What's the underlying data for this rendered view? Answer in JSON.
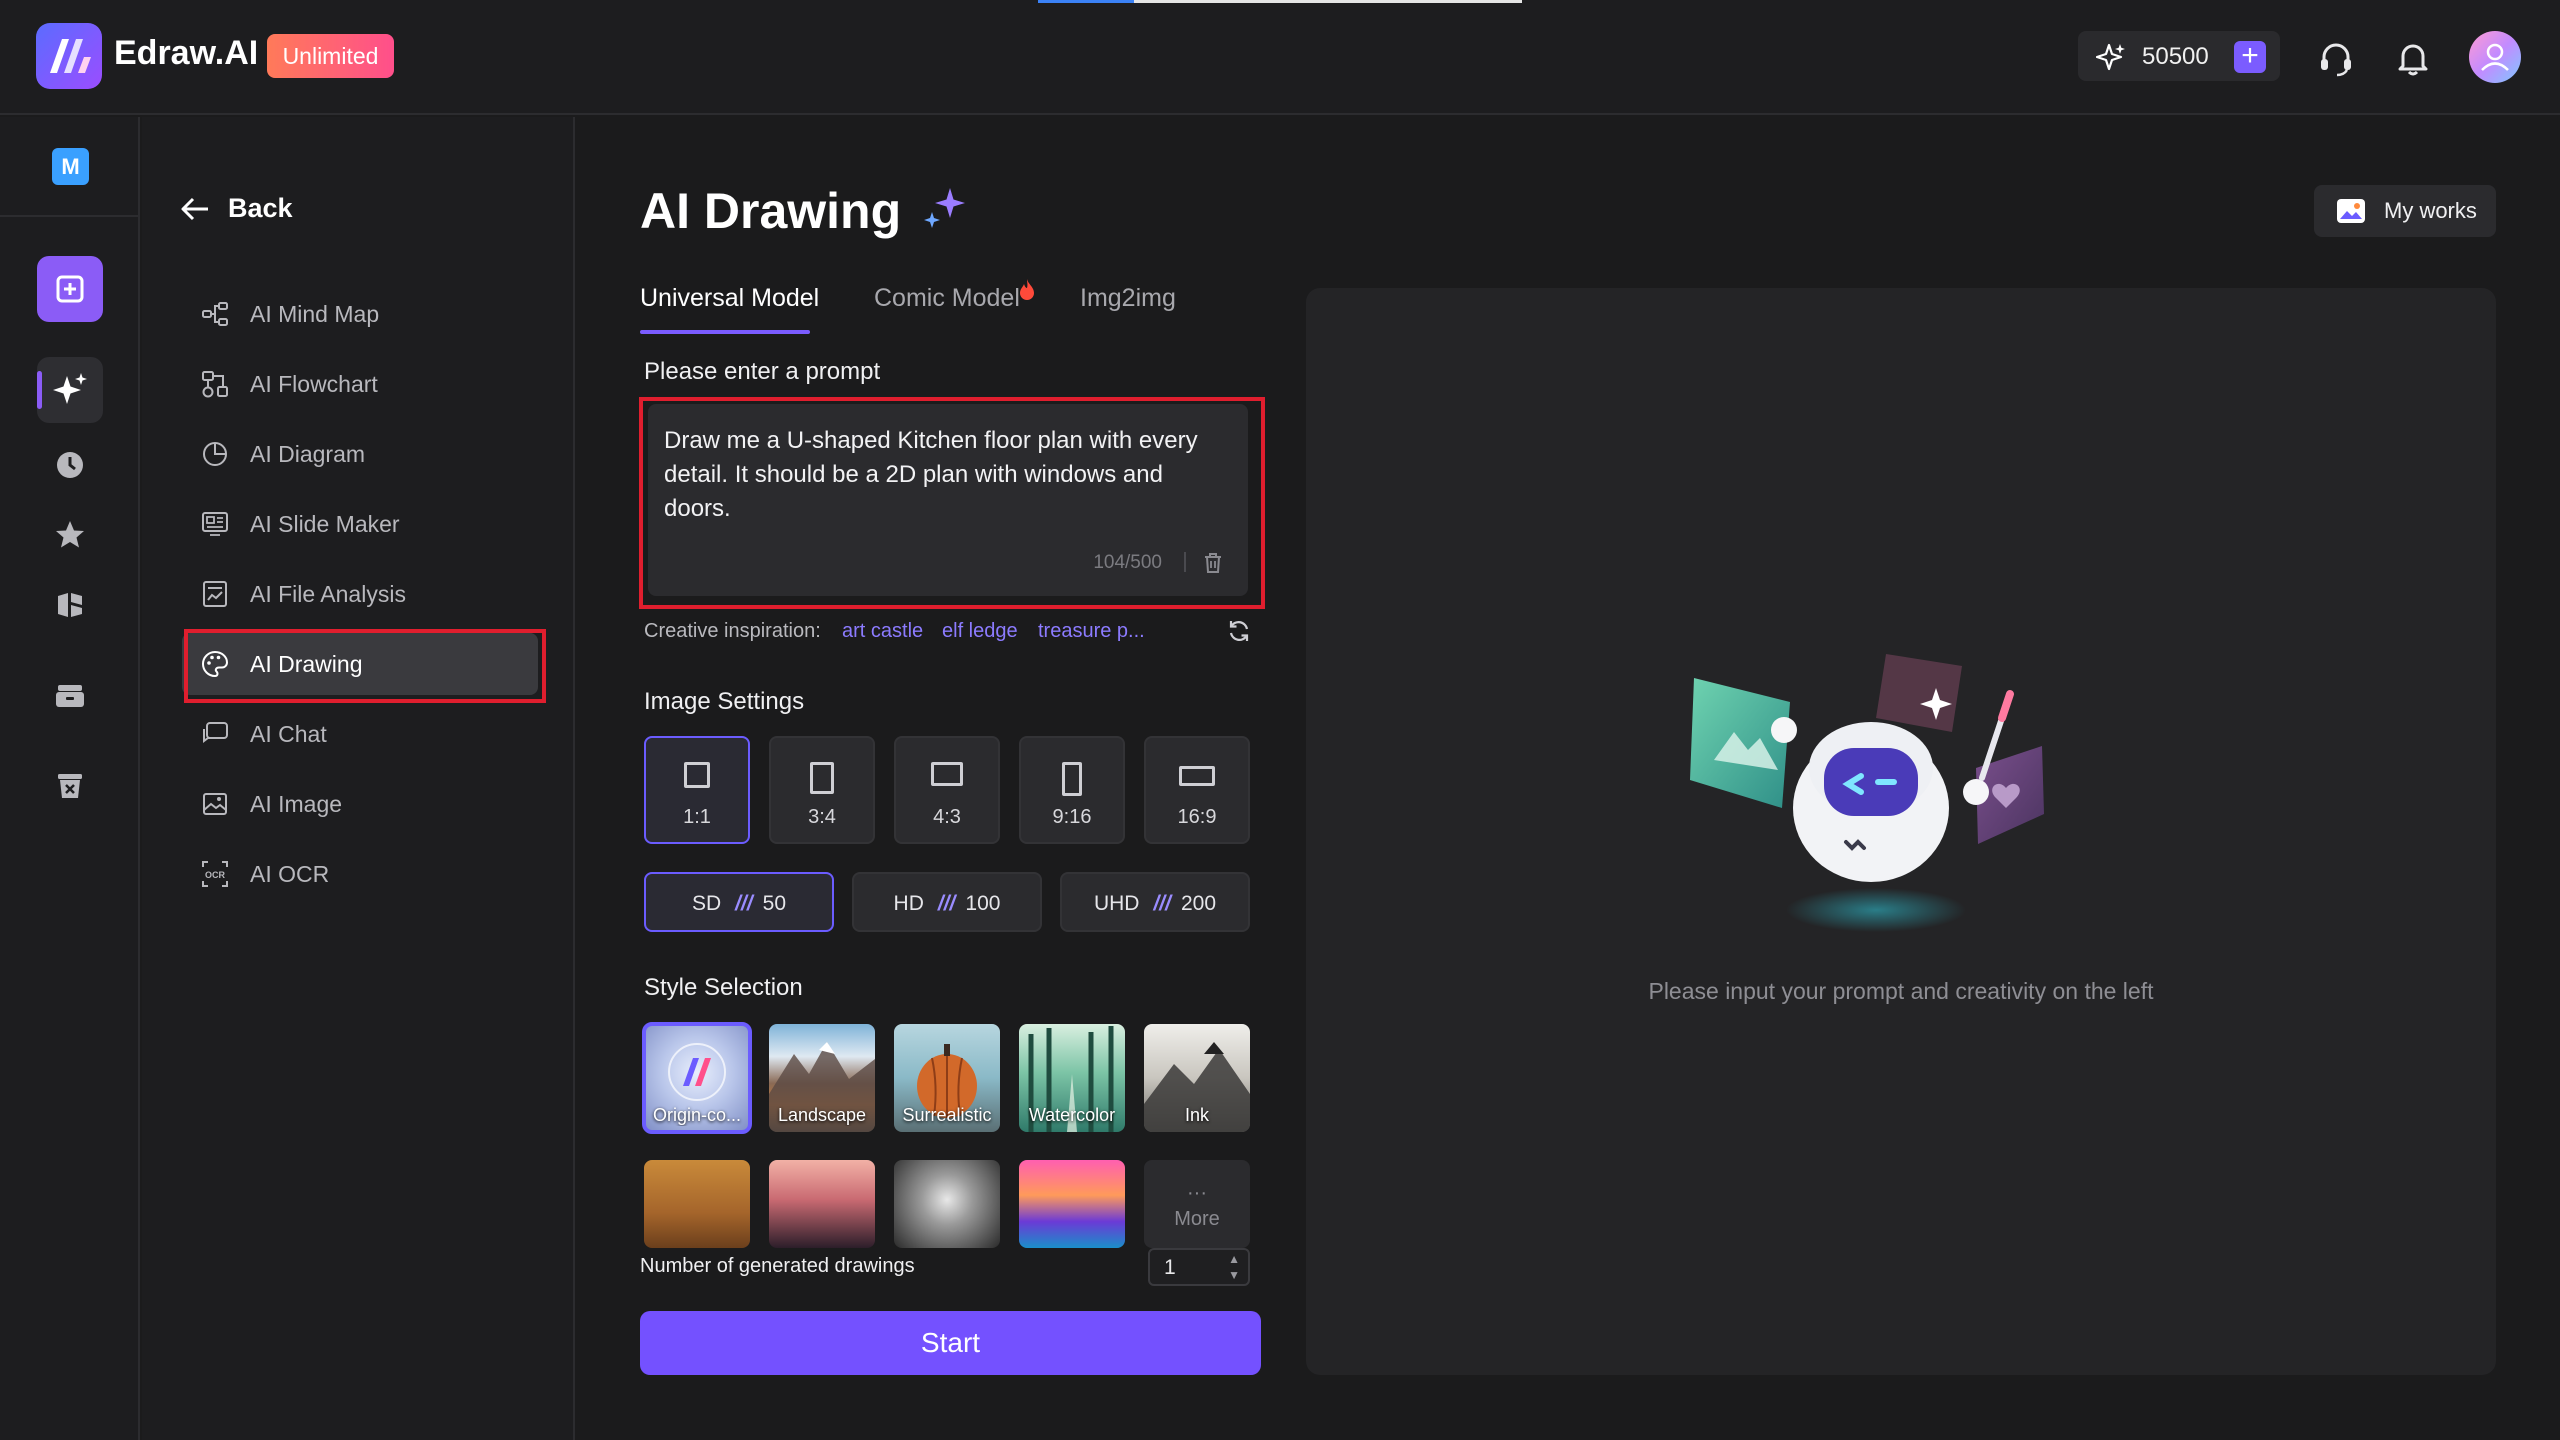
{
  "app": {
    "name": "Edraw.AI",
    "plan_badge": "Unlimited"
  },
  "topbar": {
    "credits": "50500"
  },
  "rail": {
    "workspace_initial": "M"
  },
  "sidenav": {
    "back_label": "Back",
    "items": [
      {
        "label": "AI Mind Map",
        "icon": "mind-map-icon"
      },
      {
        "label": "AI Flowchart",
        "icon": "flowchart-icon"
      },
      {
        "label": "AI Diagram",
        "icon": "diagram-icon"
      },
      {
        "label": "AI Slide Maker",
        "icon": "slide-icon"
      },
      {
        "label": "AI File Analysis",
        "icon": "file-analysis-icon"
      },
      {
        "label": "AI Drawing",
        "icon": "palette-icon",
        "active": true
      },
      {
        "label": "AI Chat",
        "icon": "chat-icon"
      },
      {
        "label": "AI Image",
        "icon": "image-icon"
      },
      {
        "label": "AI OCR",
        "icon": "ocr-icon"
      }
    ]
  },
  "main": {
    "title": "AI Drawing",
    "tabs": [
      {
        "label": "Universal Model",
        "active": true
      },
      {
        "label": "Comic Model",
        "hot": true
      },
      {
        "label": "Img2img"
      }
    ],
    "prompt": {
      "label": "Please enter a prompt",
      "value": "Draw me a U-shaped Kitchen floor plan with every detail. It should be a 2D plan with windows and doors.",
      "counter": "104/500"
    },
    "inspiration": {
      "label": "Creative inspiration:",
      "links": [
        "art castle",
        "elf ledge",
        "treasure p..."
      ]
    },
    "image_settings": {
      "label": "Image Settings",
      "ratios": [
        "1:1",
        "3:4",
        "4:3",
        "9:16",
        "16:9"
      ],
      "selected_ratio": "1:1",
      "qualities": [
        {
          "name": "SD",
          "cost": "50",
          "selected": true
        },
        {
          "name": "HD",
          "cost": "100"
        },
        {
          "name": "UHD",
          "cost": "200"
        }
      ]
    },
    "style_selection": {
      "label": "Style Selection",
      "row1": [
        "Origin-co...",
        "Landscape",
        "Surrealistic",
        "Watercolor",
        "Ink"
      ],
      "more": "More"
    },
    "count": {
      "label": "Number of generated drawings",
      "value": "1"
    },
    "start_label": "Start"
  },
  "right": {
    "my_works_label": "My works",
    "empty_text": "Please input your prompt and creativity on the left"
  },
  "colors": {
    "accent": "#7451ff",
    "highlight": "#e01e2e",
    "background": "#1b1b1c"
  }
}
